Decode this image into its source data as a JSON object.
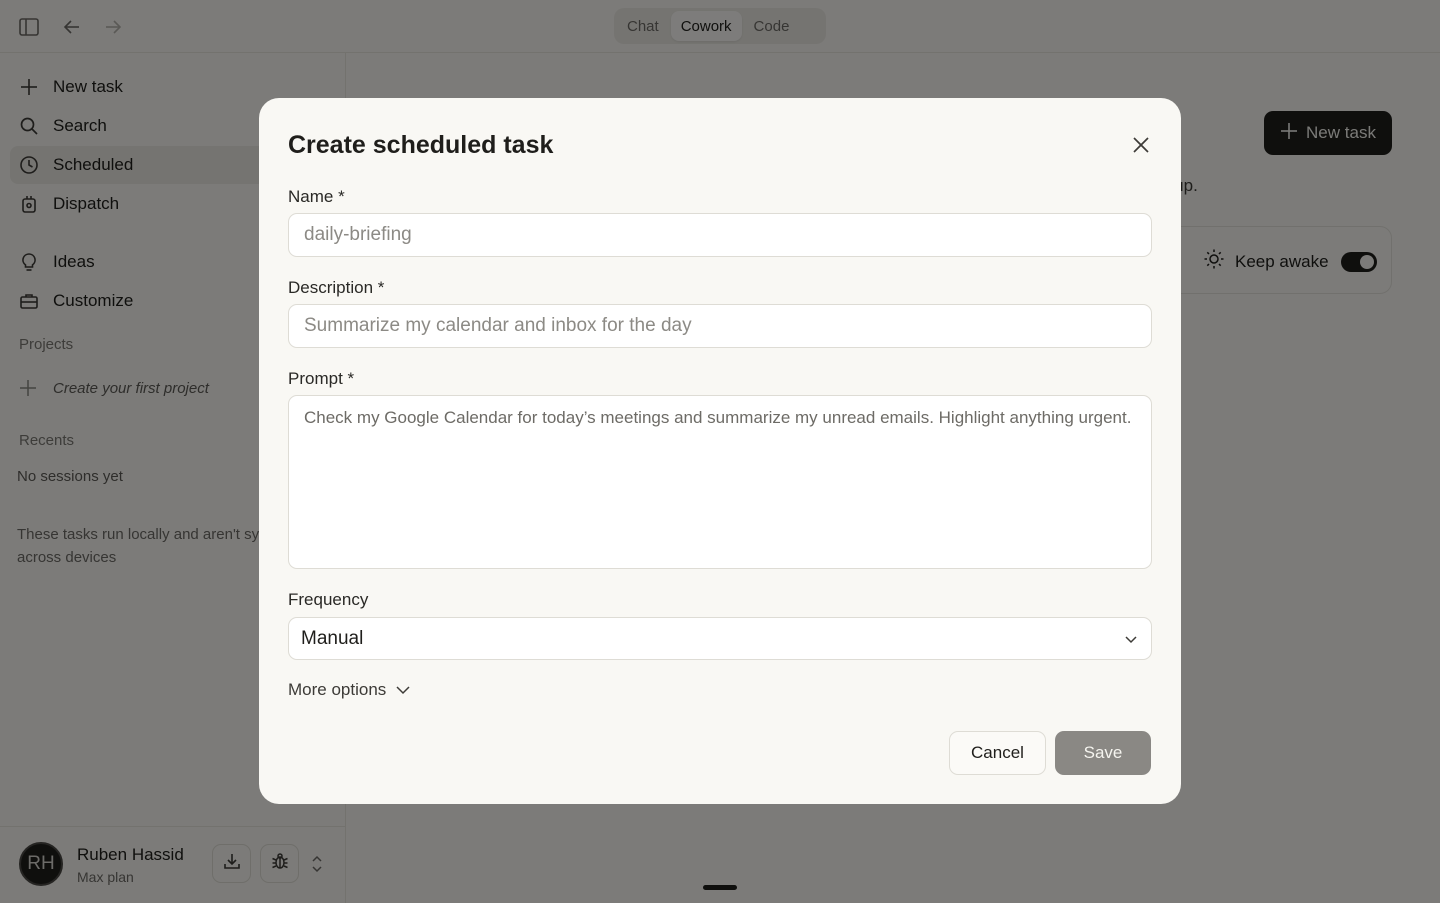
{
  "topbar": {
    "tabs": [
      {
        "label": "Chat",
        "active": false
      },
      {
        "label": "Cowork",
        "active": true
      },
      {
        "label": "Code",
        "active": false
      }
    ],
    "icons": [
      "sidebar-toggle-icon",
      "back-arrow-icon",
      "forward-arrow-icon"
    ]
  },
  "sidebar": {
    "items": [
      {
        "label": "New task",
        "icon": "plus-icon"
      },
      {
        "label": "Search",
        "icon": "search-icon"
      },
      {
        "label": "Scheduled",
        "icon": "clock-icon",
        "active": true
      },
      {
        "label": "Dispatch",
        "icon": "dispatch-icon"
      },
      {
        "label": "Ideas",
        "icon": "lightbulb-icon"
      },
      {
        "label": "Customize",
        "icon": "toolbox-icon"
      }
    ],
    "projects_label": "Projects",
    "create_project": "Create your first project",
    "recents_label": "Recents",
    "no_sessions": "No sessions yet",
    "local_note": "These tasks run locally and aren't sy",
    "local_note_2": "across devices",
    "user": {
      "initials": "RH",
      "name": "Ruben Hassid",
      "plan": "Max plan"
    }
  },
  "main": {
    "new_task_label": "New task",
    "subtitle_fragment": "e up.",
    "keep_awake_label": "Keep awake",
    "keep_awake_on": true
  },
  "modal": {
    "title": "Create scheduled task",
    "name_label": "Name *",
    "name_placeholder": "daily-briefing",
    "description_label": "Description *",
    "description_placeholder": "Summarize my calendar and inbox for the day",
    "prompt_label": "Prompt *",
    "prompt_placeholder": "Check my Google Calendar for today’s meetings and summarize my unread emails. Highlight anything urgent.",
    "frequency_label": "Frequency",
    "frequency_value": "Manual",
    "more_options": "More options",
    "cancel": "Cancel",
    "save": "Save"
  },
  "colors": {
    "overlay": "#000000",
    "primary_button": "#1f1e1b",
    "save_disabled": "#8a8884",
    "modal_bg": "#f9f8f4"
  }
}
